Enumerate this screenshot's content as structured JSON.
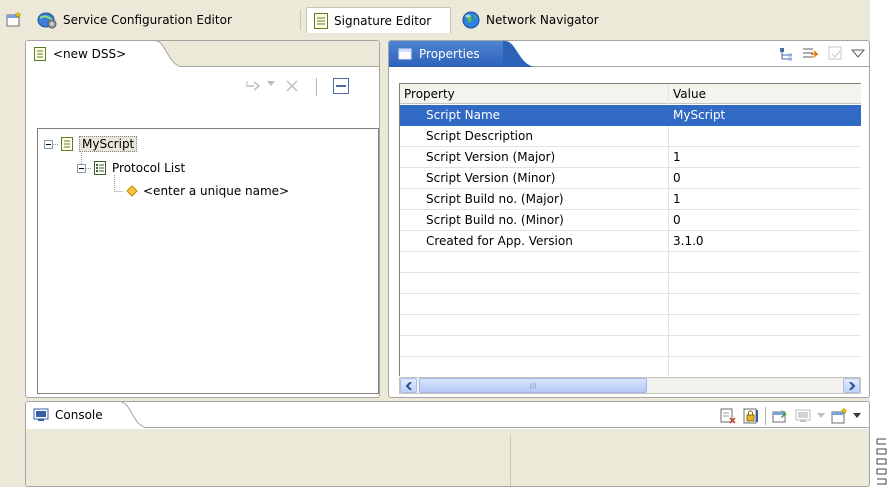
{
  "perspectives": {
    "tabs": [
      {
        "label": "Service Configuration Editor",
        "active": false
      },
      {
        "label": "Signature Editor",
        "active": true
      },
      {
        "label": "Network Navigator",
        "active": false
      }
    ]
  },
  "dss_view": {
    "tab_label": "<new DSS>",
    "tree": [
      {
        "label": "MyScript",
        "selected": true
      },
      {
        "label": "Protocol List"
      },
      {
        "label": "<enter a unique name>"
      }
    ]
  },
  "properties_view": {
    "tab_label": "Properties",
    "columns": [
      "Property",
      "Value"
    ],
    "rows": [
      {
        "property": "Script Name",
        "value": "MyScript",
        "selected": true
      },
      {
        "property": "Script Description",
        "value": ""
      },
      {
        "property": "Script Version (Major)",
        "value": "1"
      },
      {
        "property": "Script Version (Minor)",
        "value": "0"
      },
      {
        "property": "Script Build no. (Major)",
        "value": "1"
      },
      {
        "property": "Script Build no. (Minor)",
        "value": "0"
      },
      {
        "property": "Created for App. Version",
        "value": "3.1.0"
      }
    ],
    "scroll_thumb_label": "III"
  },
  "console_view": {
    "tab_label": "Console"
  },
  "colors": {
    "selection": "#316ac5",
    "panel_bg": "#ece9d8",
    "active_tab": "#2c62b8"
  }
}
